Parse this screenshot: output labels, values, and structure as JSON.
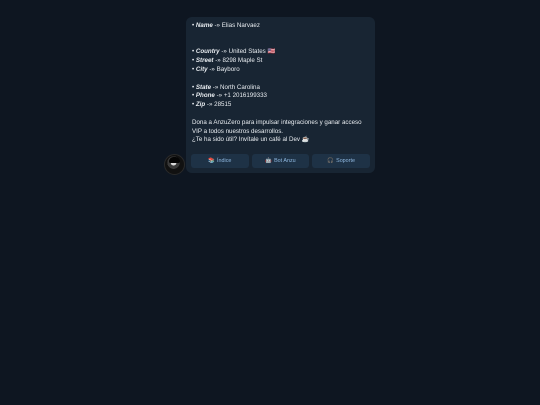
{
  "message": {
    "name_key": "Name",
    "name_val": "Elias Narvaez",
    "country_key": "Country",
    "country_val": "United States 🇺🇸",
    "street_key": "Street",
    "street_val": "8298 Maple St",
    "city_key": "City",
    "city_val": "Bayboro",
    "state_key": "State",
    "state_val": "North Carolina",
    "phone_key": "Phone",
    "phone_val": "+1 2016199333",
    "zip_key": "Zip",
    "zip_val": "28515",
    "bullet": "•",
    "arrow": "-»",
    "donate_line1": "Dona a AnzuZero para impulsar integraciones y ganar acceso",
    "donate_line2": "VIP a todos nuestros desarrollos.",
    "donate_line3": "¿Te ha sido útil? Invítale un café al Dev ☕"
  },
  "buttons": [
    {
      "icon": "📚",
      "label": "Índice"
    },
    {
      "icon": "🤖",
      "label": "Bot Anzu"
    },
    {
      "icon": "🎧",
      "label": "Soporte"
    }
  ],
  "colors": {
    "background": "#0e1621",
    "bubble": "#182533",
    "button": "#1e3246",
    "button_text": "#8fb8e0"
  }
}
